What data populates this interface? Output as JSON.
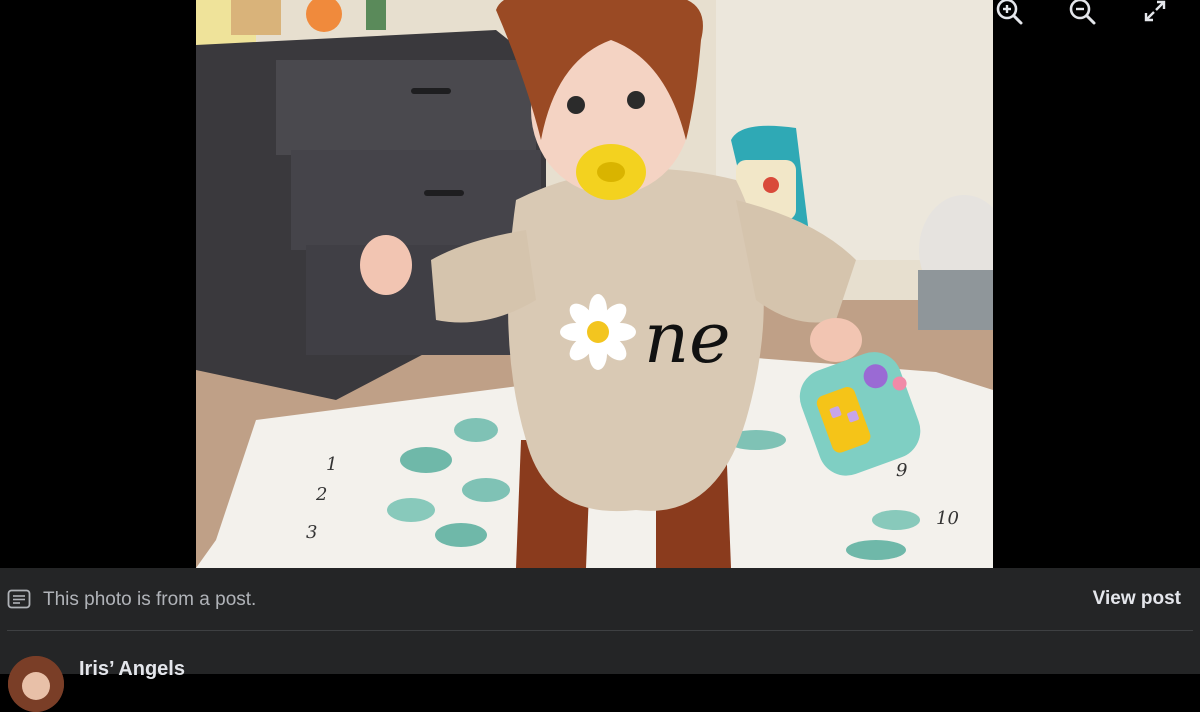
{
  "toolbar": {
    "zoom_in_icon": "zoom-in-icon",
    "zoom_out_icon": "zoom-out-icon",
    "fullscreen_icon": "expand-icon"
  },
  "photo": {
    "description_icon": "photo",
    "mat_numbers": [
      "1",
      "2",
      "3",
      "9",
      "10"
    ],
    "shirt_text": "ne"
  },
  "footer": {
    "notice_text": "This photo is from a post.",
    "view_post_label": "View post",
    "author_name": "Iris’ Angels"
  },
  "colors": {
    "background": "#000000",
    "panel": "#242526",
    "text_primary": "#e4e6eb",
    "text_secondary": "#b0b3b8"
  }
}
